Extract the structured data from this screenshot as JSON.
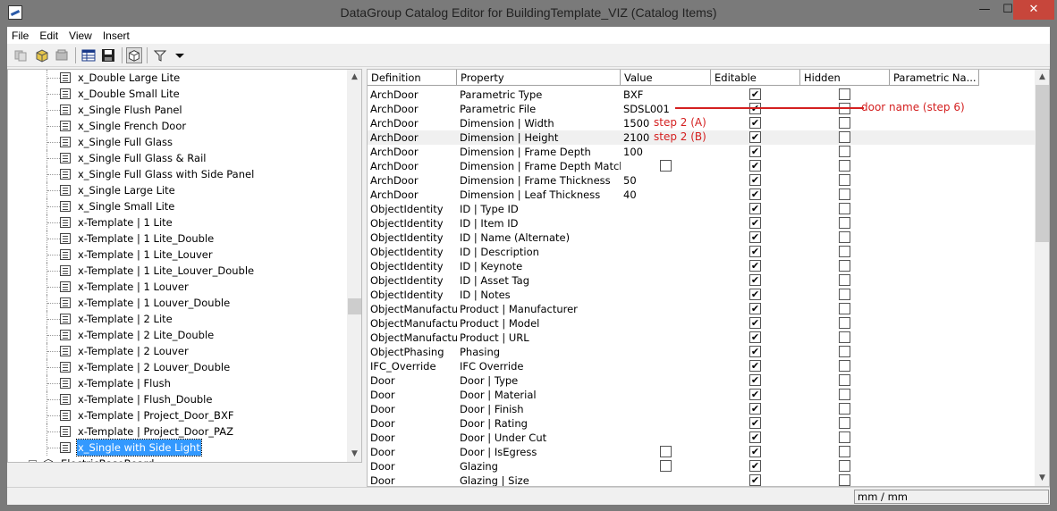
{
  "window": {
    "title": "DataGroup Catalog Editor for BuildingTemplate_VIZ (Catalog Items)",
    "minimize_glyph": "—",
    "maximize_glyph": "☐",
    "close_glyph": "✕"
  },
  "menu": [
    "File",
    "Edit",
    "View",
    "Insert"
  ],
  "toolbar_icons": [
    "copy-icon",
    "catalog-icon",
    "catalog-gray-icon",
    "table-icon",
    "save-icon",
    "cube-icon",
    "filter-icon",
    "dropdown-arrow-icon"
  ],
  "tree": {
    "items": [
      "x_Double Large Lite",
      "x_Double Small Lite",
      "x_Single Flush Panel",
      "x_Single French Door",
      "x_Single Full Glass",
      "x_Single Full Glass & Rail",
      "x_Single Full Glass with Side Panel",
      "x_Single Large Lite",
      "x_Single Small Lite",
      "x-Template | 1 Lite",
      "x-Template | 1 Lite_Double",
      "x-Template | 1 Lite_Louver",
      "x-Template | 1 Lite_Louver_Double",
      "x-Template | 1 Louver",
      "x-Template | 1 Louver_Double",
      "x-Template | 2 Lite",
      "x-Template | 2 Lite_Double",
      "x-Template | 2 Louver",
      "x-Template | 2 Louver_Double",
      "x-Template | Flush",
      "x-Template | Flush_Double",
      "x-Template | Project_Door_BXF",
      "x-Template | Project_Door_PAZ",
      "x_Single with Side Light"
    ],
    "selected_index": 23,
    "group_node": {
      "label": "ElectricBaseBoard",
      "expand": "+"
    }
  },
  "grid": {
    "columns": [
      "Definition",
      "Property",
      "Value",
      "Editable",
      "Hidden",
      "Parametric Na..."
    ],
    "rows": [
      {
        "def": "ArchDoor",
        "prop": "Parametric Type",
        "value": "BXF",
        "editable": true,
        "hidden": false,
        "valuebox": false
      },
      {
        "def": "ArchDoor",
        "prop": "Parametric File",
        "value": "SDSL001",
        "editable": true,
        "hidden": false,
        "valuebox": false
      },
      {
        "def": "ArchDoor",
        "prop": "Dimension | Width",
        "value": "1500",
        "editable": true,
        "hidden": false,
        "valuebox": false
      },
      {
        "def": "ArchDoor",
        "prop": "Dimension | Height",
        "value": "2100",
        "editable": true,
        "hidden": false,
        "valuebox": false
      },
      {
        "def": "ArchDoor",
        "prop": "Dimension | Frame Depth",
        "value": "100",
        "editable": true,
        "hidden": false,
        "valuebox": false
      },
      {
        "def": "ArchDoor",
        "prop": "Dimension | Frame Depth Match W",
        "value": "",
        "editable": true,
        "hidden": false,
        "valuebox": true
      },
      {
        "def": "ArchDoor",
        "prop": "Dimension | Frame Thickness",
        "value": "50",
        "editable": true,
        "hidden": false,
        "valuebox": false
      },
      {
        "def": "ArchDoor",
        "prop": "Dimension | Leaf Thickness",
        "value": "40",
        "editable": true,
        "hidden": false,
        "valuebox": false
      },
      {
        "def": "ObjectIdentity",
        "prop": "ID | Type ID",
        "value": "",
        "editable": true,
        "hidden": false,
        "valuebox": false
      },
      {
        "def": "ObjectIdentity",
        "prop": "ID | Item ID",
        "value": "",
        "editable": true,
        "hidden": false,
        "valuebox": false
      },
      {
        "def": "ObjectIdentity",
        "prop": "ID | Name (Alternate)",
        "value": "",
        "editable": true,
        "hidden": false,
        "valuebox": false
      },
      {
        "def": "ObjectIdentity",
        "prop": "ID | Description",
        "value": "",
        "editable": true,
        "hidden": false,
        "valuebox": false
      },
      {
        "def": "ObjectIdentity",
        "prop": "ID | Keynote",
        "value": "",
        "editable": true,
        "hidden": false,
        "valuebox": false
      },
      {
        "def": "ObjectIdentity",
        "prop": "ID | Asset Tag",
        "value": "",
        "editable": true,
        "hidden": false,
        "valuebox": false
      },
      {
        "def": "ObjectIdentity",
        "prop": "ID | Notes",
        "value": "",
        "editable": true,
        "hidden": false,
        "valuebox": false
      },
      {
        "def": "ObjectManufactu",
        "prop": "Product | Manufacturer",
        "value": "",
        "editable": true,
        "hidden": false,
        "valuebox": false
      },
      {
        "def": "ObjectManufactu",
        "prop": "Product | Model",
        "value": "",
        "editable": true,
        "hidden": false,
        "valuebox": false
      },
      {
        "def": "ObjectManufactu",
        "prop": "Product | URL",
        "value": "",
        "editable": true,
        "hidden": false,
        "valuebox": false
      },
      {
        "def": "ObjectPhasing",
        "prop": "Phasing",
        "value": "",
        "editable": true,
        "hidden": false,
        "valuebox": false
      },
      {
        "def": "IFC_Override",
        "prop": "IFC Override",
        "value": "",
        "editable": true,
        "hidden": false,
        "valuebox": false
      },
      {
        "def": "Door",
        "prop": "Door | Type",
        "value": "",
        "editable": true,
        "hidden": false,
        "valuebox": false
      },
      {
        "def": "Door",
        "prop": "Door | Material",
        "value": "",
        "editable": true,
        "hidden": false,
        "valuebox": false
      },
      {
        "def": "Door",
        "prop": "Door | Finish",
        "value": "",
        "editable": true,
        "hidden": false,
        "valuebox": false
      },
      {
        "def": "Door",
        "prop": "Door | Rating",
        "value": "",
        "editable": true,
        "hidden": false,
        "valuebox": false
      },
      {
        "def": "Door",
        "prop": "Door | Under Cut",
        "value": "",
        "editable": true,
        "hidden": false,
        "valuebox": false
      },
      {
        "def": "Door",
        "prop": "Door | IsEgress",
        "value": "",
        "editable": true,
        "hidden": false,
        "valuebox": true
      },
      {
        "def": "Door",
        "prop": "Glazing",
        "value": "",
        "editable": true,
        "hidden": false,
        "valuebox": true
      },
      {
        "def": "Door",
        "prop": "Glazing | Size",
        "value": "",
        "editable": true,
        "hidden": false,
        "valuebox": false
      }
    ],
    "highlight_row": 3,
    "check_glyph": "✔"
  },
  "annotations": {
    "door_name": "door name (step 6)",
    "step2a": "step 2 (A)",
    "step2b": "step 2 (B)",
    "color": "#d42020"
  },
  "status": {
    "units": "mm / mm"
  },
  "scroll_glyphs": {
    "up": "▲",
    "down": "▼",
    "left": "◀",
    "right": "▶"
  }
}
